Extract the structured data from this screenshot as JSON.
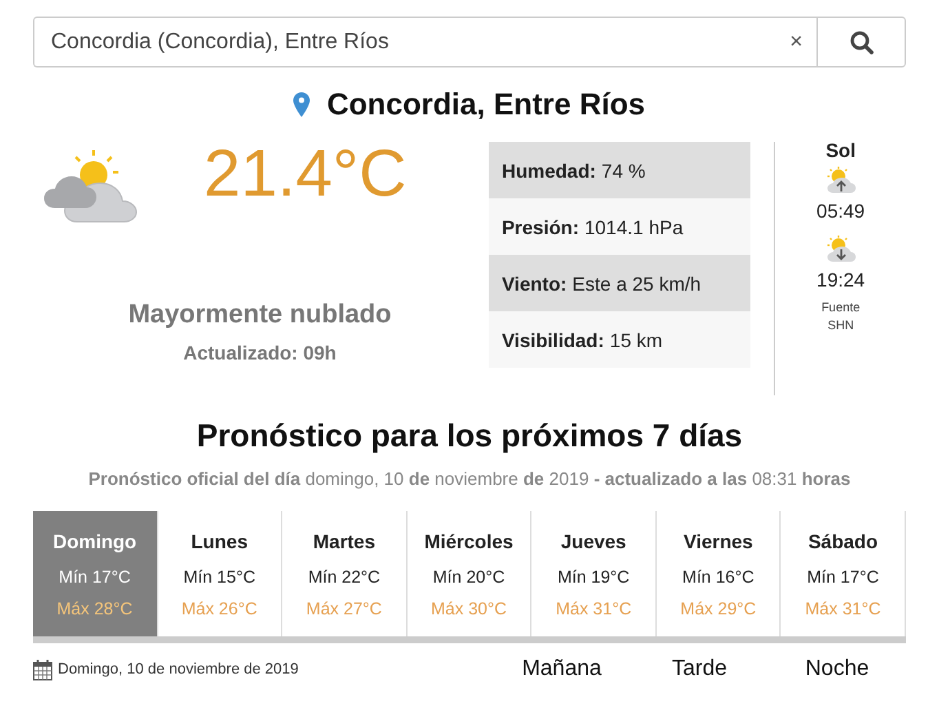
{
  "search": {
    "value": "Concordia (Concordia), Entre Ríos",
    "clear": "×"
  },
  "location": {
    "title": "Concordia, Entre Ríos"
  },
  "current": {
    "temperature": "21.4°C",
    "condition": "Mayormente nublado",
    "updated": "Actualizado: 09h"
  },
  "details": [
    {
      "label": "Humedad:",
      "value": "74 %"
    },
    {
      "label": "Presión:",
      "value": "1014.1 hPa"
    },
    {
      "label": "Viento:",
      "value": "Este a 25 km/h"
    },
    {
      "label": "Visibilidad:",
      "value": "15 km"
    }
  ],
  "sun": {
    "title": "Sol",
    "sunrise": "05:49",
    "sunset": "19:24",
    "source_line_1": "Fuente",
    "source_line_2": "SHN"
  },
  "forecast": {
    "title": "Pronóstico para los próximos 7 días",
    "subtitle": "**Pronóstico oficial del día** domingo, 10 **de** noviembre **de** 2019 **- actualizado a las** 08:31 **horas**",
    "days": [
      {
        "name": "Domingo",
        "min": "Mín 17°C",
        "max": "Máx 28°C",
        "selected": true
      },
      {
        "name": "Lunes",
        "min": "Mín 15°C",
        "max": "Máx 26°C",
        "selected": false
      },
      {
        "name": "Martes",
        "min": "Mín 22°C",
        "max": "Máx 27°C",
        "selected": false
      },
      {
        "name": "Miércoles",
        "min": "Mín 20°C",
        "max": "Máx 30°C",
        "selected": false
      },
      {
        "name": "Jueves",
        "min": "Mín 19°C",
        "max": "Máx 31°C",
        "selected": false
      },
      {
        "name": "Viernes",
        "min": "Mín 16°C",
        "max": "Máx 29°C",
        "selected": false
      },
      {
        "name": "Sábado",
        "min": "Mín 17°C",
        "max": "Máx 31°C",
        "selected": false
      }
    ],
    "date": "Domingo, 10 de noviembre de 2019",
    "periods": [
      "Mañana",
      "Tarde",
      "Noche"
    ]
  }
}
